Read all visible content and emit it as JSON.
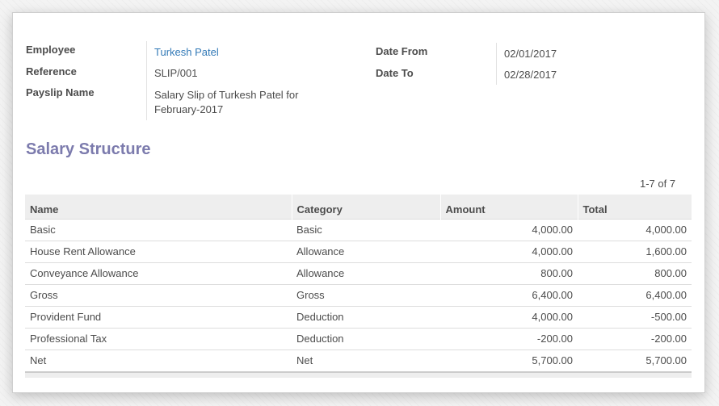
{
  "header": {
    "employee_label": "Employee",
    "employee_value": "Turkesh Patel",
    "reference_label": "Reference",
    "reference_value": "SLIP/001",
    "payslip_name_label": "Payslip Name",
    "payslip_name_line1": "Salary Slip of Turkesh Patel for",
    "payslip_name_line2": "February-2017",
    "date_from_label": "Date From",
    "date_from_value": "02/01/2017",
    "date_to_label": "Date To",
    "date_to_value": "02/28/2017"
  },
  "section": {
    "title": "Salary Structure",
    "pager": "1-7 of 7"
  },
  "table": {
    "columns": [
      "Name",
      "Category",
      "Amount",
      "Total"
    ],
    "rows": [
      {
        "name": "Basic",
        "category": "Basic",
        "amount": "4,000.00",
        "total": "4,000.00"
      },
      {
        "name": "House Rent Allowance",
        "category": "Allowance",
        "amount": "4,000.00",
        "total": "1,600.00"
      },
      {
        "name": "Conveyance Allowance",
        "category": "Allowance",
        "amount": "800.00",
        "total": "800.00"
      },
      {
        "name": "Gross",
        "category": "Gross",
        "amount": "6,400.00",
        "total": "6,400.00"
      },
      {
        "name": "Provident Fund",
        "category": "Deduction",
        "amount": "4,000.00",
        "total": "-500.00"
      },
      {
        "name": "Professional Tax",
        "category": "Deduction",
        "amount": "-200.00",
        "total": "-200.00"
      },
      {
        "name": "Net",
        "category": "Net",
        "amount": "5,700.00",
        "total": "5,700.00"
      }
    ]
  },
  "colors": {
    "section_title": "#7c7bad",
    "link": "#337ab7",
    "header_bg": "#eeeeee"
  }
}
